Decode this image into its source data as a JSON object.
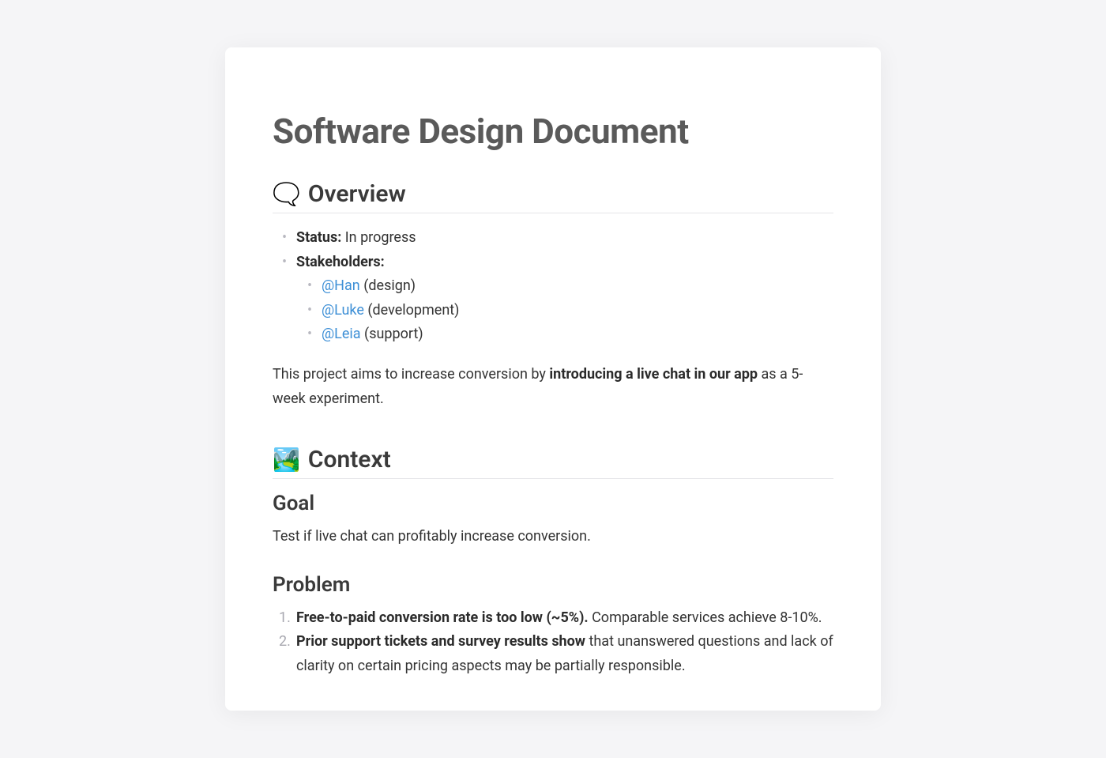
{
  "title": "Software Design Document",
  "overview": {
    "emoji": "🗨️",
    "heading": "Overview",
    "status_label": "Status:",
    "status_value": "In progress",
    "stakeholders_label": "Stakeholders:",
    "stakeholders": [
      {
        "mention": "@Han",
        "role": "(design)"
      },
      {
        "mention": "@Luke",
        "role": "(development)"
      },
      {
        "mention": "@Leia",
        "role": "(support)"
      }
    ],
    "summary_pre": "This project aims to increase conversion by ",
    "summary_bold": "introducing a live chat in our app",
    "summary_post": " as a 5-week experiment."
  },
  "context": {
    "emoji": "🏞️",
    "heading": "Context",
    "goal_heading": "Goal",
    "goal_text": "Test if live chat can profitably increase conversion.",
    "problem_heading": "Problem",
    "problems": [
      {
        "bold": "Free-to-paid conversion rate is too low (~5%).",
        "rest": " Comparable services achieve 8-10%."
      },
      {
        "bold": "Prior support tickets and survey results show",
        "rest": " that unanswered questions and lack of clarity on certain pricing aspects may be partially responsible."
      }
    ]
  }
}
